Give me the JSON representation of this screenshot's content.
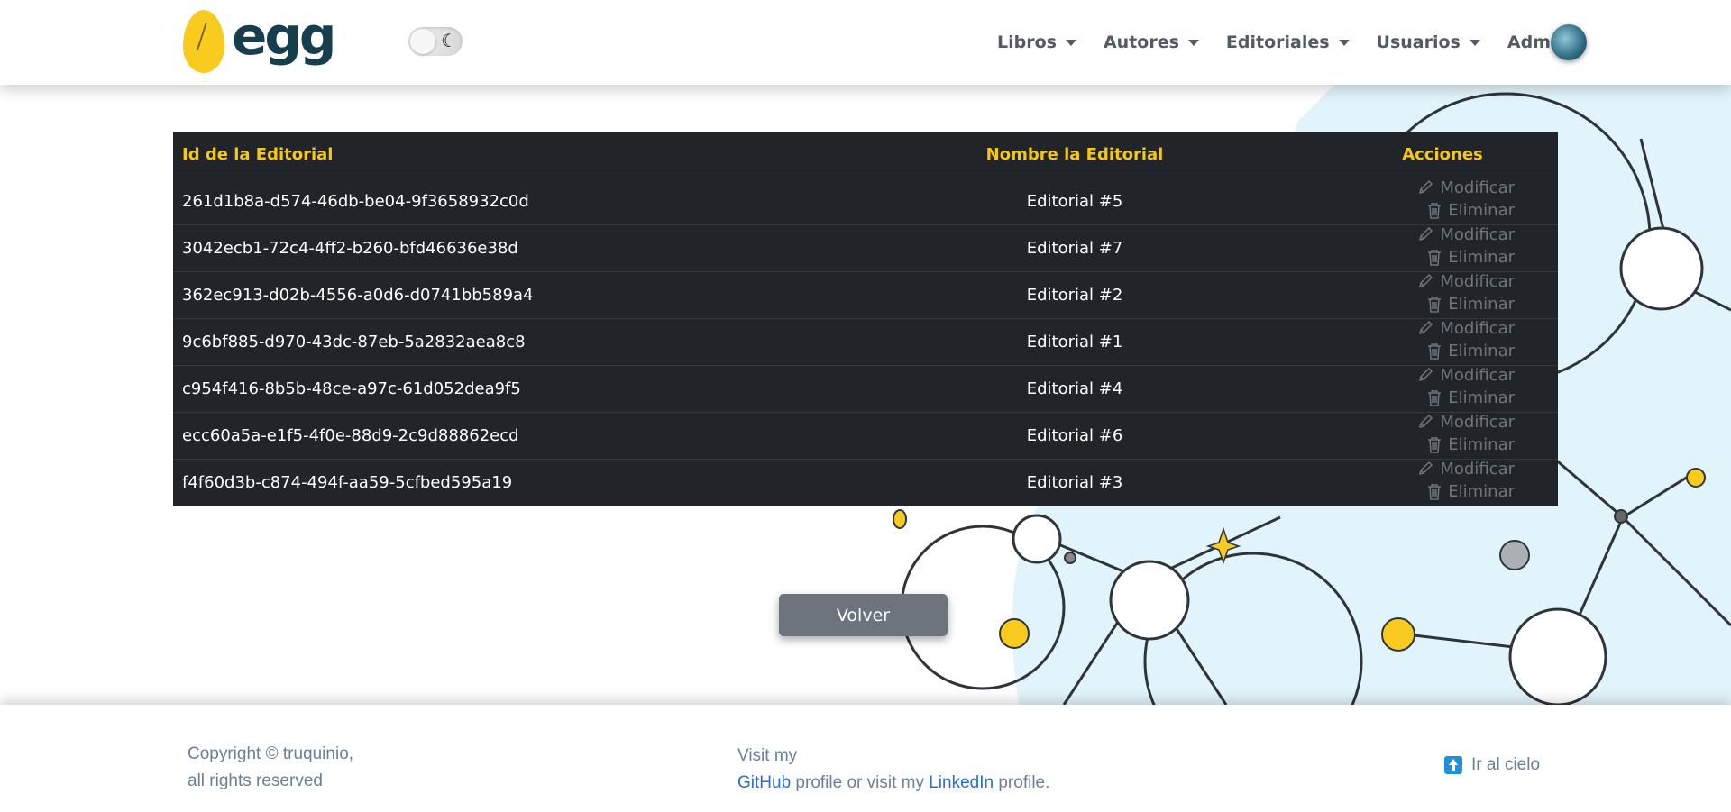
{
  "brand": {
    "logo_text": "egg"
  },
  "nav": {
    "items": [
      {
        "label": "Libros"
      },
      {
        "label": "Autores"
      },
      {
        "label": "Editoriales"
      },
      {
        "label": "Usuarios"
      },
      {
        "label": "Admin"
      }
    ]
  },
  "table": {
    "headers": {
      "id": "Id de la Editorial",
      "name": "Nombre la Editorial",
      "actions": "Acciones"
    },
    "action_labels": {
      "edit": "Modificar",
      "delete": "Eliminar"
    },
    "rows": [
      {
        "id": "261d1b8a-d574-46db-be04-9f3658932c0d",
        "name": "Editorial #5"
      },
      {
        "id": "3042ecb1-72c4-4ff2-b260-bfd46636e38d",
        "name": "Editorial #7"
      },
      {
        "id": "362ec913-d02b-4556-a0d6-d0741bb589a4",
        "name": "Editorial #2"
      },
      {
        "id": "9c6bf885-d970-43dc-87eb-5a2832aea8c8",
        "name": "Editorial #1"
      },
      {
        "id": "c954f416-8b5b-48ce-a97c-61d052dea9f5",
        "name": "Editorial #4"
      },
      {
        "id": "ecc60a5a-e1f5-4f0e-88d9-2c9d88862ecd",
        "name": "Editorial #6"
      },
      {
        "id": "f4f60d3b-c874-494f-aa59-5cfbed595a19",
        "name": "Editorial #3"
      }
    ]
  },
  "buttons": {
    "back": "Volver"
  },
  "footer": {
    "copyright_line1": "Copyright © truquinio,",
    "copyright_line2": "all rights reserved",
    "visit_line1": "Visit my",
    "github": "GitHub",
    "middle": " profile or visit my ",
    "linkedin": "LinkedIn",
    "end": " profile.",
    "to_top": "Ir al cielo"
  },
  "colors": {
    "accent": "#f6c90e",
    "table_bg": "#212529",
    "button": "#6c757d",
    "link": "#2a6fd6",
    "muted": "#6b7f96"
  }
}
